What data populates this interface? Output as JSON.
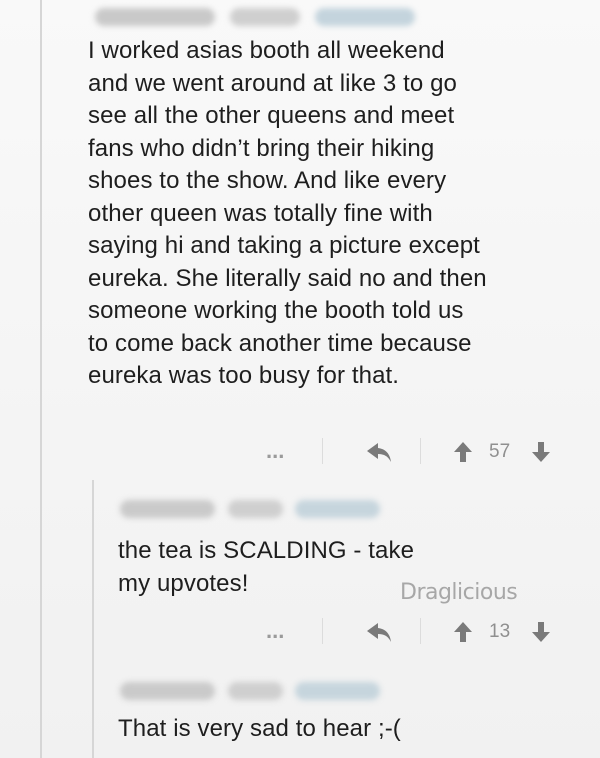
{
  "comments": [
    {
      "text": "I worked asias booth all weekend\nand we went around at like 3 to go\nsee all the other queens and meet\nfans who didn’t bring their hiking\nshoes to the show. And like every\nother queen was totally fine with\nsaying hi and taking a picture except\neureka. She literally said no and then\nsomeone working the booth told us\nto come back another time because\neureka was too busy for that.",
      "more_label": "...",
      "score": "57"
    },
    {
      "text": "the tea is SCALDING - take\nmy upvotes!",
      "more_label": "...",
      "score": "13"
    },
    {
      "text": "That is very sad to hear ;-("
    }
  ],
  "watermark": "Draglicious",
  "icons": {
    "reply": "reply-arrow-icon",
    "upvote": "upvote-arrow-icon",
    "downvote": "downvote-arrow-icon",
    "more": "more-options-icon"
  },
  "colors": {
    "text": "#1e1e1e",
    "icon": "#7a7a7a",
    "meta": "#8f8f8f"
  }
}
